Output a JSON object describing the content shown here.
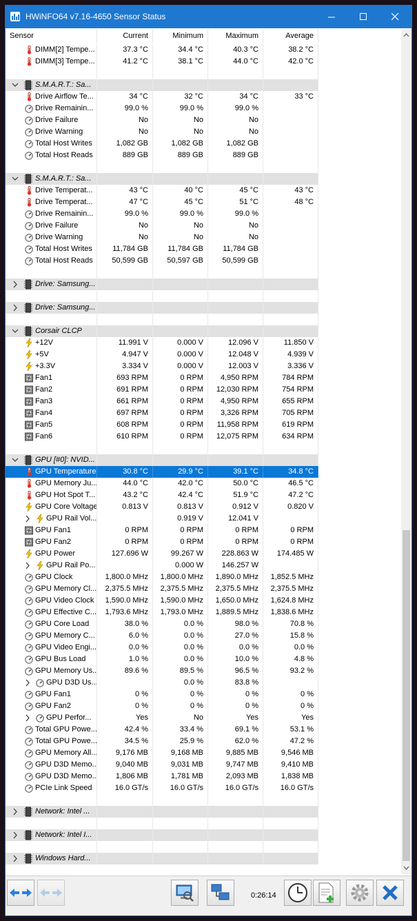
{
  "window": {
    "title": "HWiNFO64 v7.16-4650 Sensor Status",
    "accent": "#1e78d0",
    "selection_color": "#0a78d7"
  },
  "columns": [
    "Sensor",
    "Current",
    "Minimum",
    "Maximum",
    "Average"
  ],
  "rows": [
    {
      "type": "item",
      "icon": "thermometer-icon",
      "name": "DIMM[2] Tempe...",
      "current": "37.3 °C",
      "min": "34.4 °C",
      "max": "40.3 °C",
      "avg": "38.2 °C"
    },
    {
      "type": "item",
      "icon": "thermometer-icon",
      "name": "DIMM[3] Tempe...",
      "current": "41.2 °C",
      "min": "38.1 °C",
      "max": "44.0 °C",
      "avg": "42.0 °C"
    },
    {
      "type": "blank"
    },
    {
      "type": "group",
      "expanded": true,
      "icon": "chip-icon",
      "name": "S.M.A.R.T.: Sa..."
    },
    {
      "type": "item",
      "icon": "thermometer-icon",
      "name": "Drive Airflow Te...",
      "current": "34 °C",
      "min": "32 °C",
      "max": "34 °C",
      "avg": "33 °C"
    },
    {
      "type": "item",
      "icon": "gauge-icon",
      "name": "Drive Remainin...",
      "current": "99.0 %",
      "min": "99.0 %",
      "max": "99.0 %",
      "avg": ""
    },
    {
      "type": "item",
      "icon": "gauge-icon",
      "name": "Drive Failure",
      "current": "No",
      "min": "No",
      "max": "No",
      "avg": ""
    },
    {
      "type": "item",
      "icon": "gauge-icon",
      "name": "Drive Warning",
      "current": "No",
      "min": "No",
      "max": "No",
      "avg": ""
    },
    {
      "type": "item",
      "icon": "gauge-icon",
      "name": "Total Host Writes",
      "current": "1,082 GB",
      "min": "1,082 GB",
      "max": "1,082 GB",
      "avg": ""
    },
    {
      "type": "item",
      "icon": "gauge-icon",
      "name": "Total Host Reads",
      "current": "889 GB",
      "min": "889 GB",
      "max": "889 GB",
      "avg": ""
    },
    {
      "type": "blank"
    },
    {
      "type": "group",
      "expanded": true,
      "icon": "chip-icon",
      "name": "S.M.A.R.T.: Sa..."
    },
    {
      "type": "item",
      "icon": "thermometer-icon",
      "name": "Drive Temperat...",
      "current": "43 °C",
      "min": "40 °C",
      "max": "45 °C",
      "avg": "43 °C"
    },
    {
      "type": "item",
      "icon": "thermometer-icon",
      "name": "Drive Temperat...",
      "current": "47 °C",
      "min": "45 °C",
      "max": "51 °C",
      "avg": "48 °C"
    },
    {
      "type": "item",
      "icon": "gauge-icon",
      "name": "Drive Remainin...",
      "current": "99.0 %",
      "min": "99.0 %",
      "max": "99.0 %",
      "avg": ""
    },
    {
      "type": "item",
      "icon": "gauge-icon",
      "name": "Drive Failure",
      "current": "No",
      "min": "No",
      "max": "No",
      "avg": ""
    },
    {
      "type": "item",
      "icon": "gauge-icon",
      "name": "Drive Warning",
      "current": "No",
      "min": "No",
      "max": "No",
      "avg": ""
    },
    {
      "type": "item",
      "icon": "gauge-icon",
      "name": "Total Host Writes",
      "current": "11,784 GB",
      "min": "11,784 GB",
      "max": "11,784 GB",
      "avg": ""
    },
    {
      "type": "item",
      "icon": "gauge-icon",
      "name": "Total Host Reads",
      "current": "50,599 GB",
      "min": "50,597 GB",
      "max": "50,599 GB",
      "avg": ""
    },
    {
      "type": "blank"
    },
    {
      "type": "group",
      "expanded": false,
      "icon": "chip-icon",
      "name": "Drive: Samsung..."
    },
    {
      "type": "blank"
    },
    {
      "type": "group",
      "expanded": false,
      "icon": "chip-icon",
      "name": "Drive: Samsung..."
    },
    {
      "type": "blank"
    },
    {
      "type": "group",
      "expanded": true,
      "icon": "chip-icon",
      "name": "Corsair CLCP"
    },
    {
      "type": "item",
      "icon": "bolt-icon",
      "name": "+12V",
      "current": "11.991 V",
      "min": "0.000 V",
      "max": "12.096 V",
      "avg": "11.850 V"
    },
    {
      "type": "item",
      "icon": "bolt-icon",
      "name": "+5V",
      "current": "4.947 V",
      "min": "0.000 V",
      "max": "12.048 V",
      "avg": "4.939 V"
    },
    {
      "type": "item",
      "icon": "bolt-icon",
      "name": "+3.3V",
      "current": "3.334 V",
      "min": "0.000 V",
      "max": "12.003 V",
      "avg": "3.336 V"
    },
    {
      "type": "item",
      "icon": "fan-icon",
      "name": "Fan1",
      "current": "693 RPM",
      "min": "0 RPM",
      "max": "4,950 RPM",
      "avg": "784 RPM"
    },
    {
      "type": "item",
      "icon": "fan-icon",
      "name": "Fan2",
      "current": "691 RPM",
      "min": "0 RPM",
      "max": "12,030 RPM",
      "avg": "754 RPM"
    },
    {
      "type": "item",
      "icon": "fan-icon",
      "name": "Fan3",
      "current": "661 RPM",
      "min": "0 RPM",
      "max": "4,950 RPM",
      "avg": "655 RPM"
    },
    {
      "type": "item",
      "icon": "fan-icon",
      "name": "Fan4",
      "current": "697 RPM",
      "min": "0 RPM",
      "max": "3,326 RPM",
      "avg": "705 RPM"
    },
    {
      "type": "item",
      "icon": "fan-icon",
      "name": "Fan5",
      "current": "608 RPM",
      "min": "0 RPM",
      "max": "11,958 RPM",
      "avg": "619 RPM"
    },
    {
      "type": "item",
      "icon": "fan-icon",
      "name": "Fan6",
      "current": "610 RPM",
      "min": "0 RPM",
      "max": "12,075 RPM",
      "avg": "634 RPM"
    },
    {
      "type": "blank"
    },
    {
      "type": "group",
      "expanded": true,
      "icon": "chip-icon",
      "name": "GPU [#0]: NVID..."
    },
    {
      "type": "item",
      "icon": "thermometer-icon",
      "name": "GPU Temperature",
      "current": "30.8 °C",
      "min": "29.9 °C",
      "max": "39.1 °C",
      "avg": "34.8 °C",
      "selected": true
    },
    {
      "type": "item",
      "icon": "thermometer-icon",
      "name": "GPU Memory Ju...",
      "current": "44.0 °C",
      "min": "42.0 °C",
      "max": "50.0 °C",
      "avg": "46.5 °C"
    },
    {
      "type": "item",
      "icon": "thermometer-icon",
      "name": "GPU Hot Spot T...",
      "current": "43.2 °C",
      "min": "42.4 °C",
      "max": "51.9 °C",
      "avg": "47.2 °C"
    },
    {
      "type": "item",
      "icon": "bolt-icon",
      "name": "GPU Core Voltage",
      "current": "0.813 V",
      "min": "0.813 V",
      "max": "0.912 V",
      "avg": "0.820 V"
    },
    {
      "type": "item",
      "icon": "bolt-icon",
      "indent": true,
      "name": "GPU Rail Vol...",
      "current": "",
      "min": "0.919 V",
      "max": "12.041 V",
      "avg": ""
    },
    {
      "type": "item",
      "icon": "fan-icon",
      "name": "GPU Fan1",
      "current": "0 RPM",
      "min": "0 RPM",
      "max": "0 RPM",
      "avg": "0 RPM"
    },
    {
      "type": "item",
      "icon": "fan-icon",
      "name": "GPU Fan2",
      "current": "0 RPM",
      "min": "0 RPM",
      "max": "0 RPM",
      "avg": "0 RPM"
    },
    {
      "type": "item",
      "icon": "bolt-icon",
      "name": "GPU Power",
      "current": "127.696 W",
      "min": "99.267 W",
      "max": "228.863 W",
      "avg": "174.485 W"
    },
    {
      "type": "item",
      "icon": "bolt-icon",
      "indent": true,
      "name": "GPU Rail Po...",
      "current": "",
      "min": "0.000 W",
      "max": "146.257 W",
      "avg": ""
    },
    {
      "type": "item",
      "icon": "gauge-icon",
      "name": "GPU Clock",
      "current": "1,800.0 MHz",
      "min": "1,800.0 MHz",
      "max": "1,890.0 MHz",
      "avg": "1,852.5 MHz"
    },
    {
      "type": "item",
      "icon": "gauge-icon",
      "name": "GPU Memory Cl...",
      "current": "2,375.5 MHz",
      "min": "2,375.5 MHz",
      "max": "2,375.5 MHz",
      "avg": "2,375.5 MHz"
    },
    {
      "type": "item",
      "icon": "gauge-icon",
      "name": "GPU Video Clock",
      "current": "1,590.0 MHz",
      "min": "1,590.0 MHz",
      "max": "1,650.0 MHz",
      "avg": "1,624.8 MHz"
    },
    {
      "type": "item",
      "icon": "gauge-icon",
      "name": "GPU Effective C...",
      "current": "1,793.6 MHz",
      "min": "1,793.0 MHz",
      "max": "1,889.5 MHz",
      "avg": "1,838.6 MHz"
    },
    {
      "type": "item",
      "icon": "gauge-icon",
      "name": "GPU Core Load",
      "current": "38.0 %",
      "min": "0.0 %",
      "max": "98.0 %",
      "avg": "70.8 %"
    },
    {
      "type": "item",
      "icon": "gauge-icon",
      "name": "GPU Memory C...",
      "current": "6.0 %",
      "min": "0.0 %",
      "max": "27.0 %",
      "avg": "15.8 %"
    },
    {
      "type": "item",
      "icon": "gauge-icon",
      "name": "GPU Video Engi...",
      "current": "0.0 %",
      "min": "0.0 %",
      "max": "0.0 %",
      "avg": "0.0 %"
    },
    {
      "type": "item",
      "icon": "gauge-icon",
      "name": "GPU Bus Load",
      "current": "1.0 %",
      "min": "0.0 %",
      "max": "10.0 %",
      "avg": "4.8 %"
    },
    {
      "type": "item",
      "icon": "gauge-icon",
      "name": "GPU Memory Us...",
      "current": "89.6 %",
      "min": "89.5 %",
      "max": "96.5 %",
      "avg": "93.2 %"
    },
    {
      "type": "item",
      "icon": "gauge-icon",
      "indent": true,
      "name": "GPU D3D Us...",
      "current": "",
      "min": "0.0 %",
      "max": "83.8 %",
      "avg": ""
    },
    {
      "type": "item",
      "icon": "gauge-icon",
      "name": "GPU Fan1",
      "current": "0 %",
      "min": "0 %",
      "max": "0 %",
      "avg": "0 %"
    },
    {
      "type": "item",
      "icon": "gauge-icon",
      "name": "GPU Fan2",
      "current": "0 %",
      "min": "0 %",
      "max": "0 %",
      "avg": "0 %"
    },
    {
      "type": "item",
      "icon": "gauge-icon",
      "indent": true,
      "name": "GPU Perfor...",
      "current": "Yes",
      "min": "No",
      "max": "Yes",
      "avg": "Yes"
    },
    {
      "type": "item",
      "icon": "gauge-icon",
      "name": "Total GPU Powe...",
      "current": "42.4 %",
      "min": "33.4 %",
      "max": "69.1 %",
      "avg": "53.1 %"
    },
    {
      "type": "item",
      "icon": "gauge-icon",
      "name": "Total GPU Powe...",
      "current": "34.5 %",
      "min": "25.9 %",
      "max": "62.0 %",
      "avg": "47.2 %"
    },
    {
      "type": "item",
      "icon": "gauge-icon",
      "name": "GPU Memory All...",
      "current": "9,176 MB",
      "min": "9,168 MB",
      "max": "9,885 MB",
      "avg": "9,546 MB"
    },
    {
      "type": "item",
      "icon": "gauge-icon",
      "name": "GPU D3D Memo...",
      "current": "9,040 MB",
      "min": "9,031 MB",
      "max": "9,747 MB",
      "avg": "9,410 MB"
    },
    {
      "type": "item",
      "icon": "gauge-icon",
      "name": "GPU D3D Memo...",
      "current": "1,806 MB",
      "min": "1,781 MB",
      "max": "2,093 MB",
      "avg": "1,838 MB"
    },
    {
      "type": "item",
      "icon": "gauge-icon",
      "name": "PCIe Link Speed",
      "current": "16.0 GT/s",
      "min": "16.0 GT/s",
      "max": "16.0 GT/s",
      "avg": "16.0 GT/s"
    },
    {
      "type": "blank"
    },
    {
      "type": "group",
      "expanded": false,
      "icon": "chip-icon",
      "name": "Network: Intel ..."
    },
    {
      "type": "blank"
    },
    {
      "type": "group",
      "expanded": false,
      "icon": "chip-icon",
      "name": "Network: Intel I..."
    },
    {
      "type": "blank"
    },
    {
      "type": "group",
      "expanded": false,
      "icon": "chip-icon",
      "name": "Windows Hard..."
    }
  ],
  "toolbar": {
    "timer": "0:26:14",
    "buttons": [
      "nav-arrows-icon",
      "nav-arrows-disabled-icon",
      "report-icon",
      "network-icon",
      "clock-icon",
      "add-log-icon",
      "settings-icon",
      "close-icon"
    ]
  }
}
